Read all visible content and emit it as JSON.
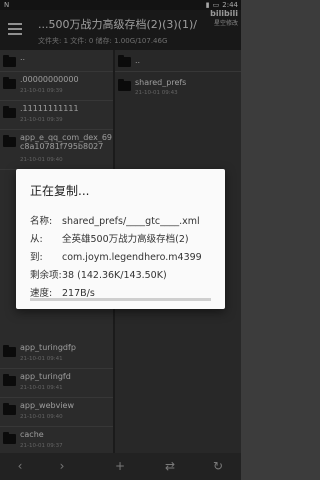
{
  "status_bar": {
    "network": "N",
    "time": "2:44"
  },
  "watermark": {
    "brand": "bilibili",
    "channel": "星空修改"
  },
  "app_bar": {
    "title": "...500万战力高级存档(2)(3)(1)/",
    "subtitle": "文件夹: 1  文件: 0  储存: 1.00G/107.46G"
  },
  "left_pane": {
    "up_label": "..",
    "items": [
      {
        "name": ".00000000000",
        "date": "21-10-01 09:39"
      },
      {
        "name": ".11111111111",
        "date": "21-10-01 09:39"
      },
      {
        "name": "app_e_qq_com_dex_69c8a10781f795b8027",
        "date": "21-10-01 09:40"
      },
      {
        "name": "app_turingdfp",
        "date": "21-10-01 09:41"
      },
      {
        "name": "app_turingfd",
        "date": "21-10-01 09:41"
      },
      {
        "name": "app_webview",
        "date": "21-10-01 09:40"
      },
      {
        "name": "cache",
        "date": "21-10-01 09:37"
      }
    ]
  },
  "right_pane": {
    "up_label": "..",
    "items": [
      {
        "name": "shared_prefs",
        "date": "21-10-01 09:43"
      }
    ]
  },
  "dialog": {
    "title": "正在复制...",
    "name_label": "名称:",
    "name_value": "shared_prefs/____gtc____.xml",
    "from_label": "从:",
    "from_value": "全英雄500万战力高级存档(2)",
    "to_label": "到:",
    "to_value": "com.joym.legendhero.m4399",
    "remaining_label": "剩余项:",
    "remaining_value": "38 (142.36K/143.50K)",
    "speed_label": "速度:",
    "speed_value": "217B/s",
    "progress_fraction": 0.99
  },
  "bottom_bar": {
    "back": "‹",
    "forward": "›",
    "add": "+",
    "swap": "⇄",
    "refresh": "↻"
  },
  "colors": {
    "dialog_bg": "#fafafa",
    "pane_bg": "#424242",
    "app_bar": "#262626"
  }
}
